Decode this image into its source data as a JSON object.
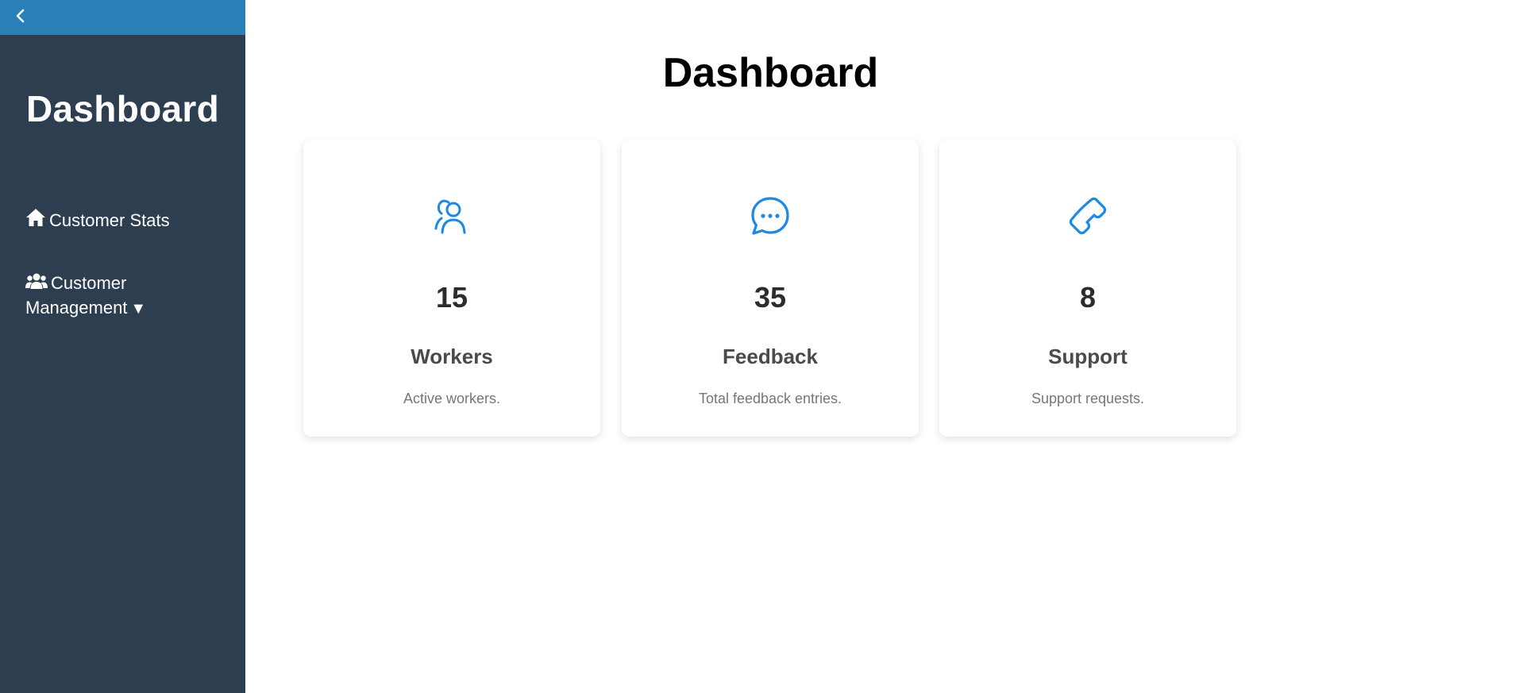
{
  "sidebar": {
    "collapse_icon": "chevron-left-icon",
    "title": "Dashboard",
    "items": [
      {
        "label": "Customer Stats",
        "icon": "home-icon"
      },
      {
        "label": "Customer Management",
        "icon": "users-icon",
        "caret": "▼"
      }
    ]
  },
  "main": {
    "title": "Dashboard",
    "cards": [
      {
        "icon": "user-group-icon",
        "value": "15",
        "label": "Workers",
        "description": "Active workers."
      },
      {
        "icon": "chat-bubble-icon",
        "value": "35",
        "label": "Feedback",
        "description": "Total feedback entries."
      },
      {
        "icon": "phone-icon",
        "value": "8",
        "label": "Support",
        "description": "Support requests."
      }
    ]
  },
  "colors": {
    "sidebar_bg": "#2c3e50",
    "collapse_bar_bg": "#2980b9",
    "accent": "#1e88e5"
  }
}
